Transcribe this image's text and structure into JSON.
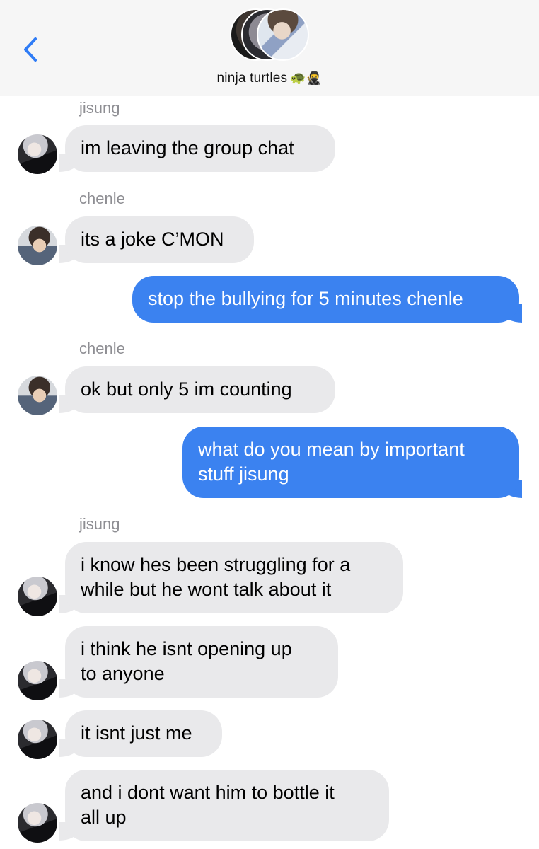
{
  "header": {
    "group_name": "ninja turtles",
    "group_emoji": "🐢🥷"
  },
  "messages": {
    "m1_sender": "jisung",
    "m1_text": "im leaving the group chat",
    "m2_sender": "chenle",
    "m2_text": "its a joke C’MON",
    "m3_text": "stop the bullying for 5 minutes chenle",
    "m4_sender": "chenle",
    "m4_text": "ok but only 5 im counting",
    "m5_line1": "what do you mean by important",
    "m5_line2": "stuff jisung",
    "m6_sender": "jisung",
    "m6_line1": "i know hes been struggling for a",
    "m6_line2": "while but he wont talk about it",
    "m7_line1": "i think he isnt opening up",
    "m7_line2": "to anyone",
    "m8_text": "it isnt just me",
    "m9_line1": "and i dont want him to bottle it",
    "m9_line2": "all up"
  },
  "colors": {
    "outgoing_bubble": "#3b82f0",
    "incoming_bubble": "#e9e9eb",
    "back_chevron": "#2f7cf6"
  }
}
